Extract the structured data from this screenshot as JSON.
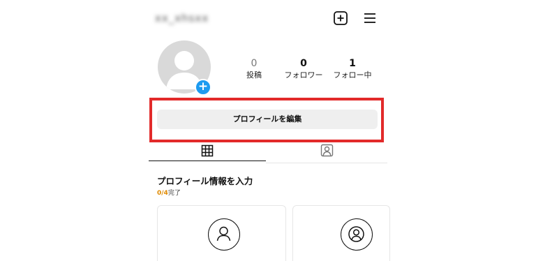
{
  "header": {
    "username": "xx_xhsxx",
    "new_post_icon": "plus-square-icon",
    "menu_icon": "hamburger-menu-icon"
  },
  "profile": {
    "avatar_badge": "+",
    "stats": [
      {
        "value": "0",
        "label": "投稿"
      },
      {
        "value": "0",
        "label": "フォロワー"
      },
      {
        "value": "1",
        "label": "フォロー中"
      }
    ],
    "edit_button_label": "プロフィールを編集"
  },
  "tabs": [
    {
      "icon": "grid-icon",
      "active": true
    },
    {
      "icon": "tagged-person-icon",
      "active": false
    }
  ],
  "completion": {
    "title": "プロフィール情報を入力",
    "count": "0/4",
    "suffix": "完了"
  },
  "cards": [
    {
      "icon": "person-outline-icon"
    },
    {
      "icon": "person-circle-icon"
    }
  ],
  "colors": {
    "highlight_border": "#e22a2a",
    "badge_blue": "#1d9bf0",
    "progress_orange": "#e08a00"
  }
}
